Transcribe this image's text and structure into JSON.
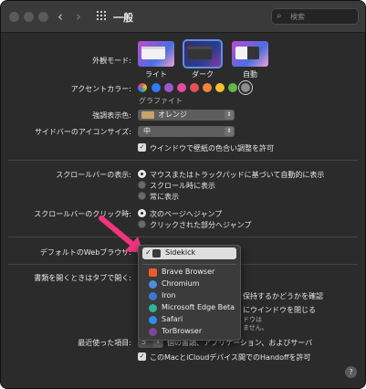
{
  "window": {
    "title": "一般"
  },
  "toolbar": {
    "back": "‹",
    "forward": "›",
    "search_placeholder": "検索"
  },
  "appearance": {
    "label": "外観モード:",
    "options": [
      "ライト",
      "ダーク",
      "自動"
    ]
  },
  "accent": {
    "label": "アクセントカラー:",
    "caption": "グラファイト",
    "colors": [
      "#2f7cf6",
      "#9b59d0",
      "#e24d9c",
      "#e8504f",
      "#f0863a",
      "#f2c12e",
      "#5fba47",
      "#8d8d8d"
    ]
  },
  "highlight": {
    "label": "強調表示色:",
    "value": "オレンジ"
  },
  "sidebar_icon": {
    "label": "サイドバーのアイコンサイズ:",
    "value": "中"
  },
  "tint": {
    "label": "ウインドウで壁紙の色合い調整を許可"
  },
  "scrollbar": {
    "label": "スクロールバーの表示:",
    "options": [
      "マウスまたはトラックパッドに基づいて自動的に表示",
      "スクロール時に表示",
      "常に表示"
    ]
  },
  "click_scroll": {
    "label": "スクロールバーのクリック時:",
    "options": [
      "次のページへジャンプ",
      "クリックされた部分へジャンプ"
    ]
  },
  "browser": {
    "label": "デフォルトのWebブラウザ:",
    "selected": "Sidekick",
    "items": [
      "Brave Browser",
      "Chromium",
      "Iron",
      "Microsoft Edge Beta",
      "Safari",
      "TorBrowser"
    ]
  },
  "tabs": {
    "label": "書類を開くときはタブで開く:",
    "partial1": "保持するかどうかを確認",
    "partial2": "にウインドウを閉じる",
    "partial3": "ドウは",
    "partial4": "ません。"
  },
  "recent": {
    "label": "最近使った項目:",
    "value": "5",
    "text": "個の書類、アプリケーション、およびサーバ"
  },
  "handoff": {
    "label": "このMacとiCloudデバイス間でのHandoffを許可"
  },
  "help": "?"
}
